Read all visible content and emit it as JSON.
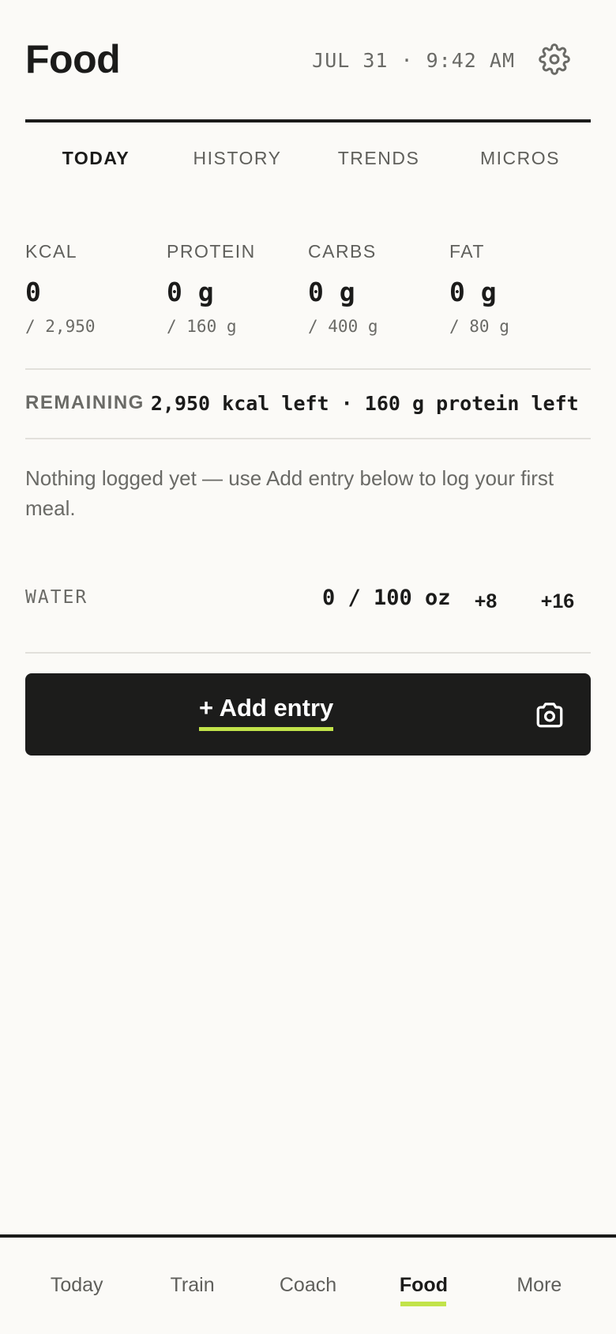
{
  "header": {
    "title": "Food",
    "datetime": "JUL 31 · 9:42 AM",
    "settings_icon": "gear-icon"
  },
  "tabs": [
    {
      "label": "TODAY",
      "active": true
    },
    {
      "label": "HISTORY",
      "active": false
    },
    {
      "label": "TRENDS",
      "active": false
    },
    {
      "label": "MICROS",
      "active": false
    }
  ],
  "macros": [
    {
      "label": "KCAL",
      "value": "0",
      "target": "/ 2,950"
    },
    {
      "label": "PROTEIN",
      "value": "0 g",
      "target": "/ 160 g"
    },
    {
      "label": "CARBS",
      "value": "0 g",
      "target": "/ 400 g"
    },
    {
      "label": "FAT",
      "value": "0 g",
      "target": "/ 80 g"
    }
  ],
  "remaining": {
    "label": "REMAINING",
    "text": "2,950 kcal left · 160 g protein left"
  },
  "empty_message": "Nothing logged yet — use Add entry below to log your first meal.",
  "water": {
    "label": "WATER",
    "count": "0 / 100 oz",
    "buttons": [
      "+8",
      "+16"
    ]
  },
  "add_entry": {
    "label": "+ Add entry",
    "camera_icon": "camera-icon"
  },
  "bottom_nav": [
    {
      "label": "Today",
      "active": false
    },
    {
      "label": "Train",
      "active": false
    },
    {
      "label": "Coach",
      "active": false
    },
    {
      "label": "Food",
      "active": true
    },
    {
      "label": "More",
      "active": false
    }
  ],
  "colors": {
    "accent": "#c2e34a",
    "background": "#fbfaf7",
    "ink": "#1b1b1a",
    "muted": "#6a6a66"
  }
}
